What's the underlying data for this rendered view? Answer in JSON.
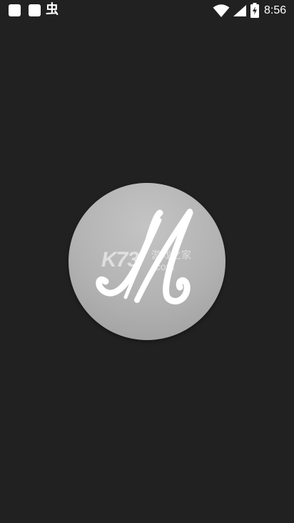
{
  "status_bar": {
    "notification_icons": [
      "app-notification-icon",
      "app-notification-icon",
      "bug-icon"
    ],
    "notification_glyph": "虫",
    "wifi_icon": "wifi-icon",
    "signal_icon": "cell-signal-icon",
    "battery_icon": "battery-charging-icon",
    "time": "8:56"
  },
  "splash": {
    "logo_icon": "marshall-m-logo-icon",
    "logo_letter": "M",
    "watermark": {
      "brand": "K73",
      "chinese_text": "游戏之家",
      "domain": ".com"
    }
  },
  "colors": {
    "background": "#212121",
    "logo_circle": "#b2b2b2",
    "logo_letter": "#ffffff"
  }
}
